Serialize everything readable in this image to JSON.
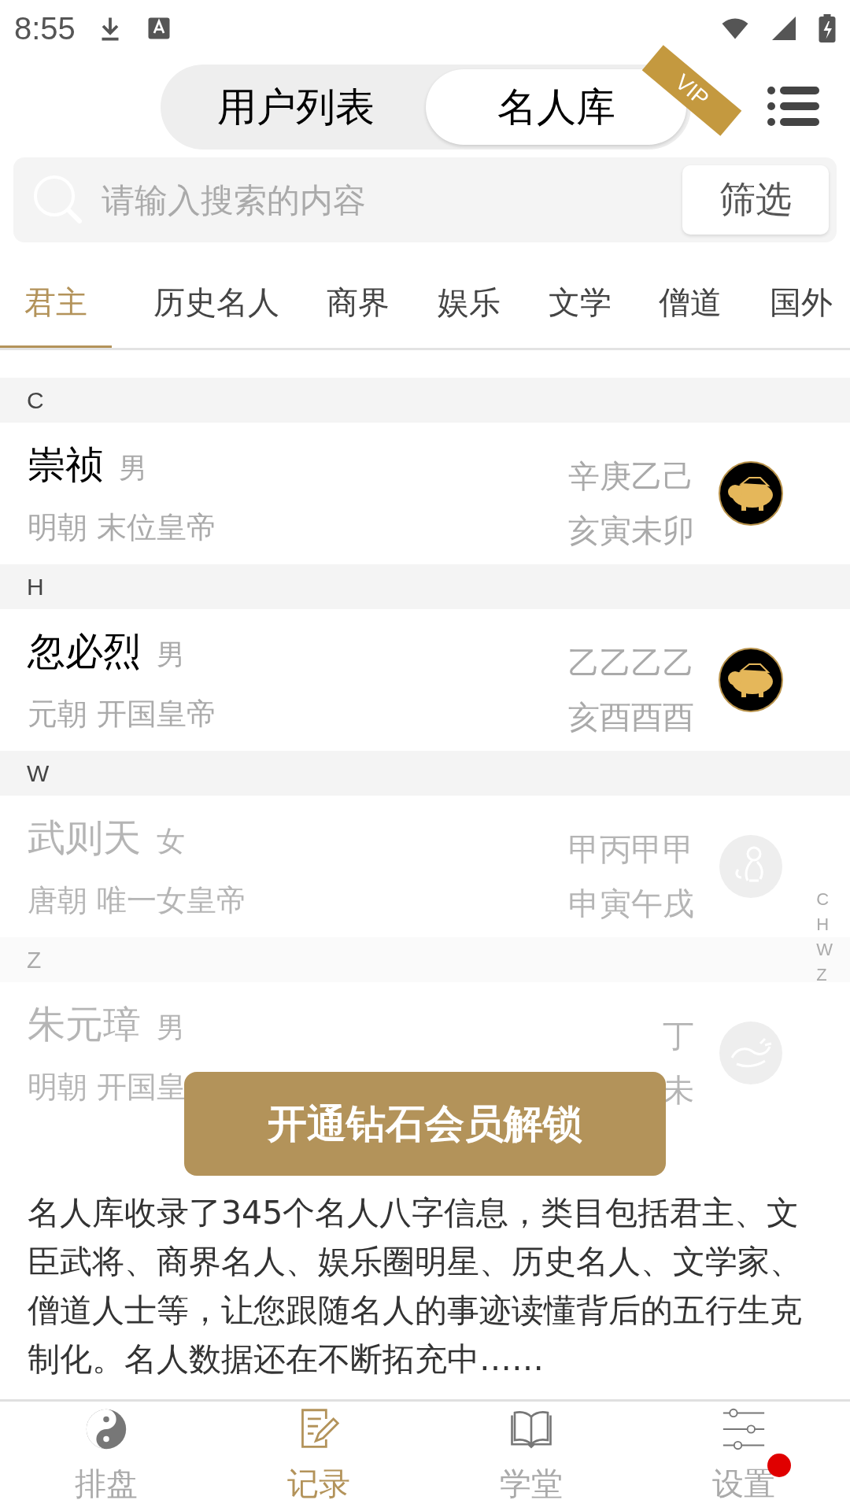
{
  "status_bar": {
    "time": "8:55"
  },
  "segments": [
    {
      "label": "用户列表",
      "selected": false,
      "vip": false
    },
    {
      "label": "名人库",
      "selected": true,
      "vip": true
    }
  ],
  "vip_ribbon": "VIP",
  "search": {
    "placeholder": "请输入搜索的内容",
    "filter_button": "筛选"
  },
  "categories": [
    {
      "label": "君主",
      "selected": true
    },
    {
      "label": "历史名人",
      "selected": false
    },
    {
      "label": "商界",
      "selected": false
    },
    {
      "label": "娱乐",
      "selected": false
    },
    {
      "label": "文学",
      "selected": false
    },
    {
      "label": "僧道",
      "selected": false
    },
    {
      "label": "国外",
      "selected": false
    }
  ],
  "sections": [
    {
      "letter": "C",
      "locked": false,
      "people": [
        {
          "name": "崇祯",
          "gender": "男",
          "desc": "明朝 末位皇帝",
          "bazi_top": "辛庚乙己",
          "bazi_bottom": "亥寅未卯",
          "kind": "pig",
          "locked": false
        }
      ]
    },
    {
      "letter": "H",
      "locked": false,
      "people": [
        {
          "name": "忽必烈",
          "gender": "男",
          "desc": "元朝 开国皇帝",
          "bazi_top": "乙乙乙乙",
          "bazi_bottom": "亥酉酉酉",
          "kind": "pig",
          "locked": false
        }
      ]
    },
    {
      "letter": "W",
      "locked": false,
      "people": [
        {
          "name": "武则天",
          "gender": "女",
          "desc": "唐朝 唯一女皇帝",
          "bazi_top": "甲丙甲甲",
          "bazi_bottom": "申寅午戌",
          "kind": "monkey",
          "locked": true
        }
      ]
    },
    {
      "letter": "Z",
      "locked": true,
      "people": [
        {
          "name": "朱元璋",
          "gender": "男",
          "desc": "明朝 开国皇",
          "bazi_top": "丁",
          "bazi_bottom": "未",
          "kind": "dragon",
          "locked": true
        }
      ]
    }
  ],
  "index_letters": [
    "C",
    "H",
    "W",
    "Z"
  ],
  "unlock_button": "开通钻石会员解锁",
  "description": "名人库收录了345个名人八字信息，类目包括君主、文臣武将、商界名人、娱乐圈明星、历史名人、文学家、僧道人士等，让您跟随名人的事迹读懂背后的五行生克制化。名人数据还在不断拓充中……",
  "bottom_nav": [
    {
      "label": "排盘",
      "kind": "yinyang",
      "selected": false,
      "badge": false
    },
    {
      "label": "记录",
      "kind": "note",
      "selected": true,
      "badge": false
    },
    {
      "label": "学堂",
      "kind": "book",
      "selected": false,
      "badge": false
    },
    {
      "label": "设置",
      "kind": "sliders",
      "selected": false,
      "badge": true
    }
  ]
}
